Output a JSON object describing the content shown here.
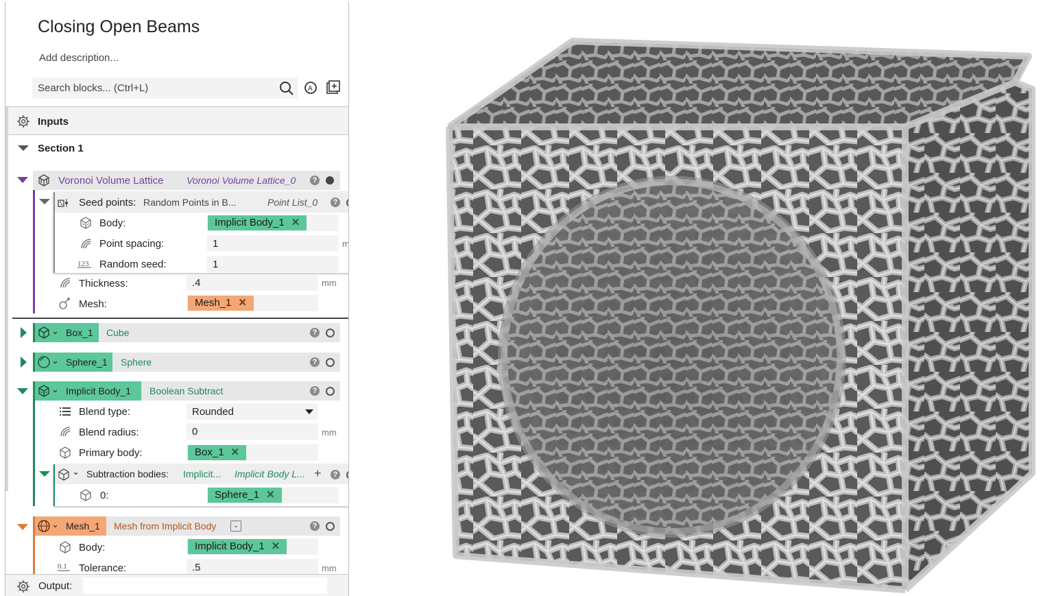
{
  "header": {
    "title": "Closing Open Beams",
    "description": "Add description...",
    "search_placeholder": "Search blocks... (Ctrl+L)"
  },
  "inputs_label": "Inputs",
  "section_label": "Section 1",
  "voronoi": {
    "name": "Voronoi Volume Lattice",
    "instance": "Voronoi Volume Lattice_0",
    "seed": {
      "label": "Seed points:",
      "value": "Random Points in B...",
      "instance": "Point List_0",
      "body_label": "Body:",
      "body_value": "Implicit Body_1",
      "spacing_label": "Point spacing:",
      "spacing_value": "1",
      "spacing_unit": "mm",
      "random_label": "Random seed:",
      "random_value": "1"
    },
    "thickness_label": "Thickness:",
    "thickness_value": ".4",
    "thickness_unit": "mm",
    "mesh_label": "Mesh:",
    "mesh_value": "Mesh_1"
  },
  "box": {
    "name": "Box_1",
    "type": "Cube"
  },
  "sphere": {
    "name": "Sphere_1",
    "type": "Sphere"
  },
  "implicit": {
    "name": "Implicit Body_1",
    "type": "Boolean Subtract",
    "blend_type_label": "Blend type:",
    "blend_type_value": "Rounded",
    "blend_radius_label": "Blend radius:",
    "blend_radius_value": "0",
    "blend_radius_unit": "mm",
    "primary_label": "Primary body:",
    "primary_value": "Box_1",
    "subtraction_label": "Subtraction bodies:",
    "subtraction_value": "Implicit...",
    "subtraction_instance": "Implicit Body L...",
    "item_index": "0:",
    "item_value": "Sphere_1"
  },
  "mesh": {
    "name": "Mesh_1",
    "type": "Mesh from Implicit Body",
    "body_label": "Body:",
    "body_value": "Implicit Body_1",
    "tolerance_label": "Tolerance:",
    "tolerance_value": ".5",
    "tolerance_unit": "mm"
  },
  "output_label": "Output:",
  "icons": [
    "search-icon",
    "ai-icon",
    "add-block-icon",
    "gear-icon",
    "lattice-icon",
    "seed-points-icon",
    "implicit-body-icon",
    "spacing-icon",
    "number-icon",
    "thickness-icon",
    "mesh-icon",
    "cube-icon",
    "sphere-icon",
    "list-icon",
    "tolerance-icon",
    "help-icon"
  ],
  "colors": {
    "purple": "#7a3fa0",
    "green": "#1f8a5a",
    "green_tag": "#5cc79a",
    "orange": "#e07b39",
    "orange_tag": "#f4a775"
  }
}
